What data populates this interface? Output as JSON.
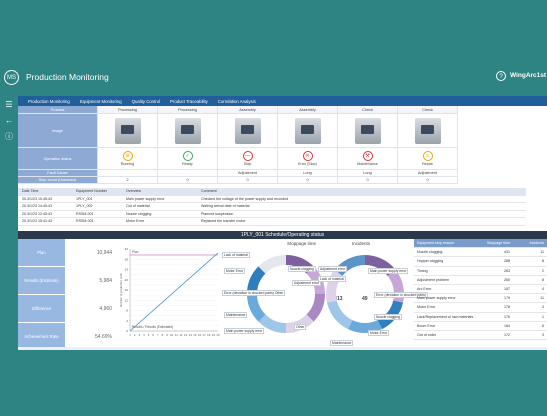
{
  "app": {
    "title": "Production Monitoring",
    "logo": "MS",
    "brand": "WingArc1st"
  },
  "nav": [
    "Production Monitoring",
    "Equipment Monitoring",
    "Quality Control",
    "Product Traceability",
    "Correlation Analysis"
  ],
  "equipment": {
    "row_labels": {
      "process": "Process",
      "image": "Image",
      "operation": "Operation status",
      "cause": "Fault Cause",
      "stop_count": "Stop count (Unknown)"
    },
    "columns": [
      {
        "process": "Processing",
        "status": "Running",
        "icon": "gear-icon",
        "cause": "",
        "count": "2"
      },
      {
        "process": "Processing",
        "status": "Ready",
        "icon": "check-icon",
        "cause": "",
        "count": "0"
      },
      {
        "process": "Assembly",
        "status": "Stop",
        "icon": "stop-icon",
        "cause": "Adjustment",
        "count": "0"
      },
      {
        "process": "Assembly",
        "status": "Error (Stop)",
        "icon": "error-icon",
        "cause": "Long",
        "count": "0"
      },
      {
        "process": "Check",
        "status": "Maintenance",
        "icon": "wrench-icon",
        "cause": "Long",
        "count": "0"
      },
      {
        "process": "Check",
        "status": "Repair",
        "icon": "repair-icon",
        "cause": "Adjustment",
        "count": "0"
      }
    ]
  },
  "alarms": {
    "headers": [
      "Date Time",
      "Equipment Number",
      "Overview",
      "Comment"
    ],
    "rows": [
      [
        "20.3/1/23 10:45:43",
        "1PLY_001",
        "Main power supply error",
        "Checked the voltage of the power supply and recorded"
      ],
      [
        "20.3/1/23 14:45:43",
        "1PLY_002",
        "Out of material",
        "Waiting arrival date of material"
      ],
      [
        "20.3/1/23 12:45:43",
        "RSSM-001",
        "Nozzle clogging",
        "Planned suspension"
      ],
      [
        "20.3/1/23 15:41:43",
        "RSSM-001",
        "Motor Error",
        "Replaced the transfer motor"
      ]
    ]
  },
  "section_title": "1PLY_001 Schedule/Operating status",
  "kpis": [
    {
      "label": "Plan",
      "value": "10,944"
    },
    {
      "label": "Results (Estimate)",
      "value": "5,984"
    },
    {
      "label": "Difference",
      "value": "4,960"
    },
    {
      "label": "Achievement Rate",
      "value": "54.69%"
    }
  ],
  "line_chart": {
    "series": [
      "Results",
      "Plan",
      "Results (Estimated)"
    ],
    "ylabel": "Number of production units",
    "y_ticks": [
      "0",
      "2",
      "4",
      "6",
      "8",
      "10",
      "12",
      "14",
      "16",
      "18",
      "20",
      "22",
      "24",
      "26",
      "28",
      "30",
      "32"
    ],
    "x_ticks": [
      "1",
      "2",
      "3",
      "4",
      "5",
      "6",
      "7",
      "8",
      "9",
      "10",
      "11",
      "12",
      "13",
      "14",
      "15",
      "16",
      "17",
      "18",
      "19",
      "20"
    ]
  },
  "stoppage_donut": {
    "title": "Stoppage time",
    "center": "1,813",
    "segment_colors": [
      "#7f5f9e",
      "#c7a6d8",
      "#a889c4",
      "#dcd2ea",
      "#9ec6e8",
      "#6aa9dc",
      "#2f7fbf",
      "#e6e6ef"
    ],
    "labels": [
      "Lack of material",
      "Motor Error",
      "Error (deviation in chucked parts) Other",
      "Maintenance",
      "Main power supply error",
      "Nozzle clogging",
      "Adjustment error",
      "Other"
    ]
  },
  "incidents_donut": {
    "title": "Incidents",
    "center": "49",
    "segment_colors": [
      "#7f5f9e",
      "#c7a6d8",
      "#2f7fbf",
      "#6aa9dc",
      "#9ec6e8",
      "#dcd2ea",
      "#5b95c6"
    ],
    "labels": [
      "Adjustment error",
      "Lack of material",
      "Main power supply error",
      "Error (deviation in chucked parts)",
      "Nozzle clogging",
      "Motor Error",
      "Maintenance"
    ]
  },
  "reasons": {
    "headers": [
      "Equipment stop reason",
      "Stoppage time",
      "Incidents"
    ],
    "rows": [
      [
        "Nozzle clogging",
        "431",
        "11"
      ],
      [
        "Hopper clogging",
        "288",
        "8"
      ],
      [
        "Timing",
        "263",
        "2"
      ],
      [
        "Adjustment problem",
        "260",
        "8"
      ],
      [
        "Arc Error",
        "187",
        "4"
      ],
      [
        "Main power supply error",
        "179",
        "11"
      ],
      [
        "Motor Error",
        "178",
        "3"
      ],
      [
        "Lack/Replacement of raw materials",
        "176",
        "1"
      ],
      [
        "Boom Error",
        "164",
        "6"
      ],
      [
        "Out of order",
        "172",
        "3"
      ]
    ]
  }
}
